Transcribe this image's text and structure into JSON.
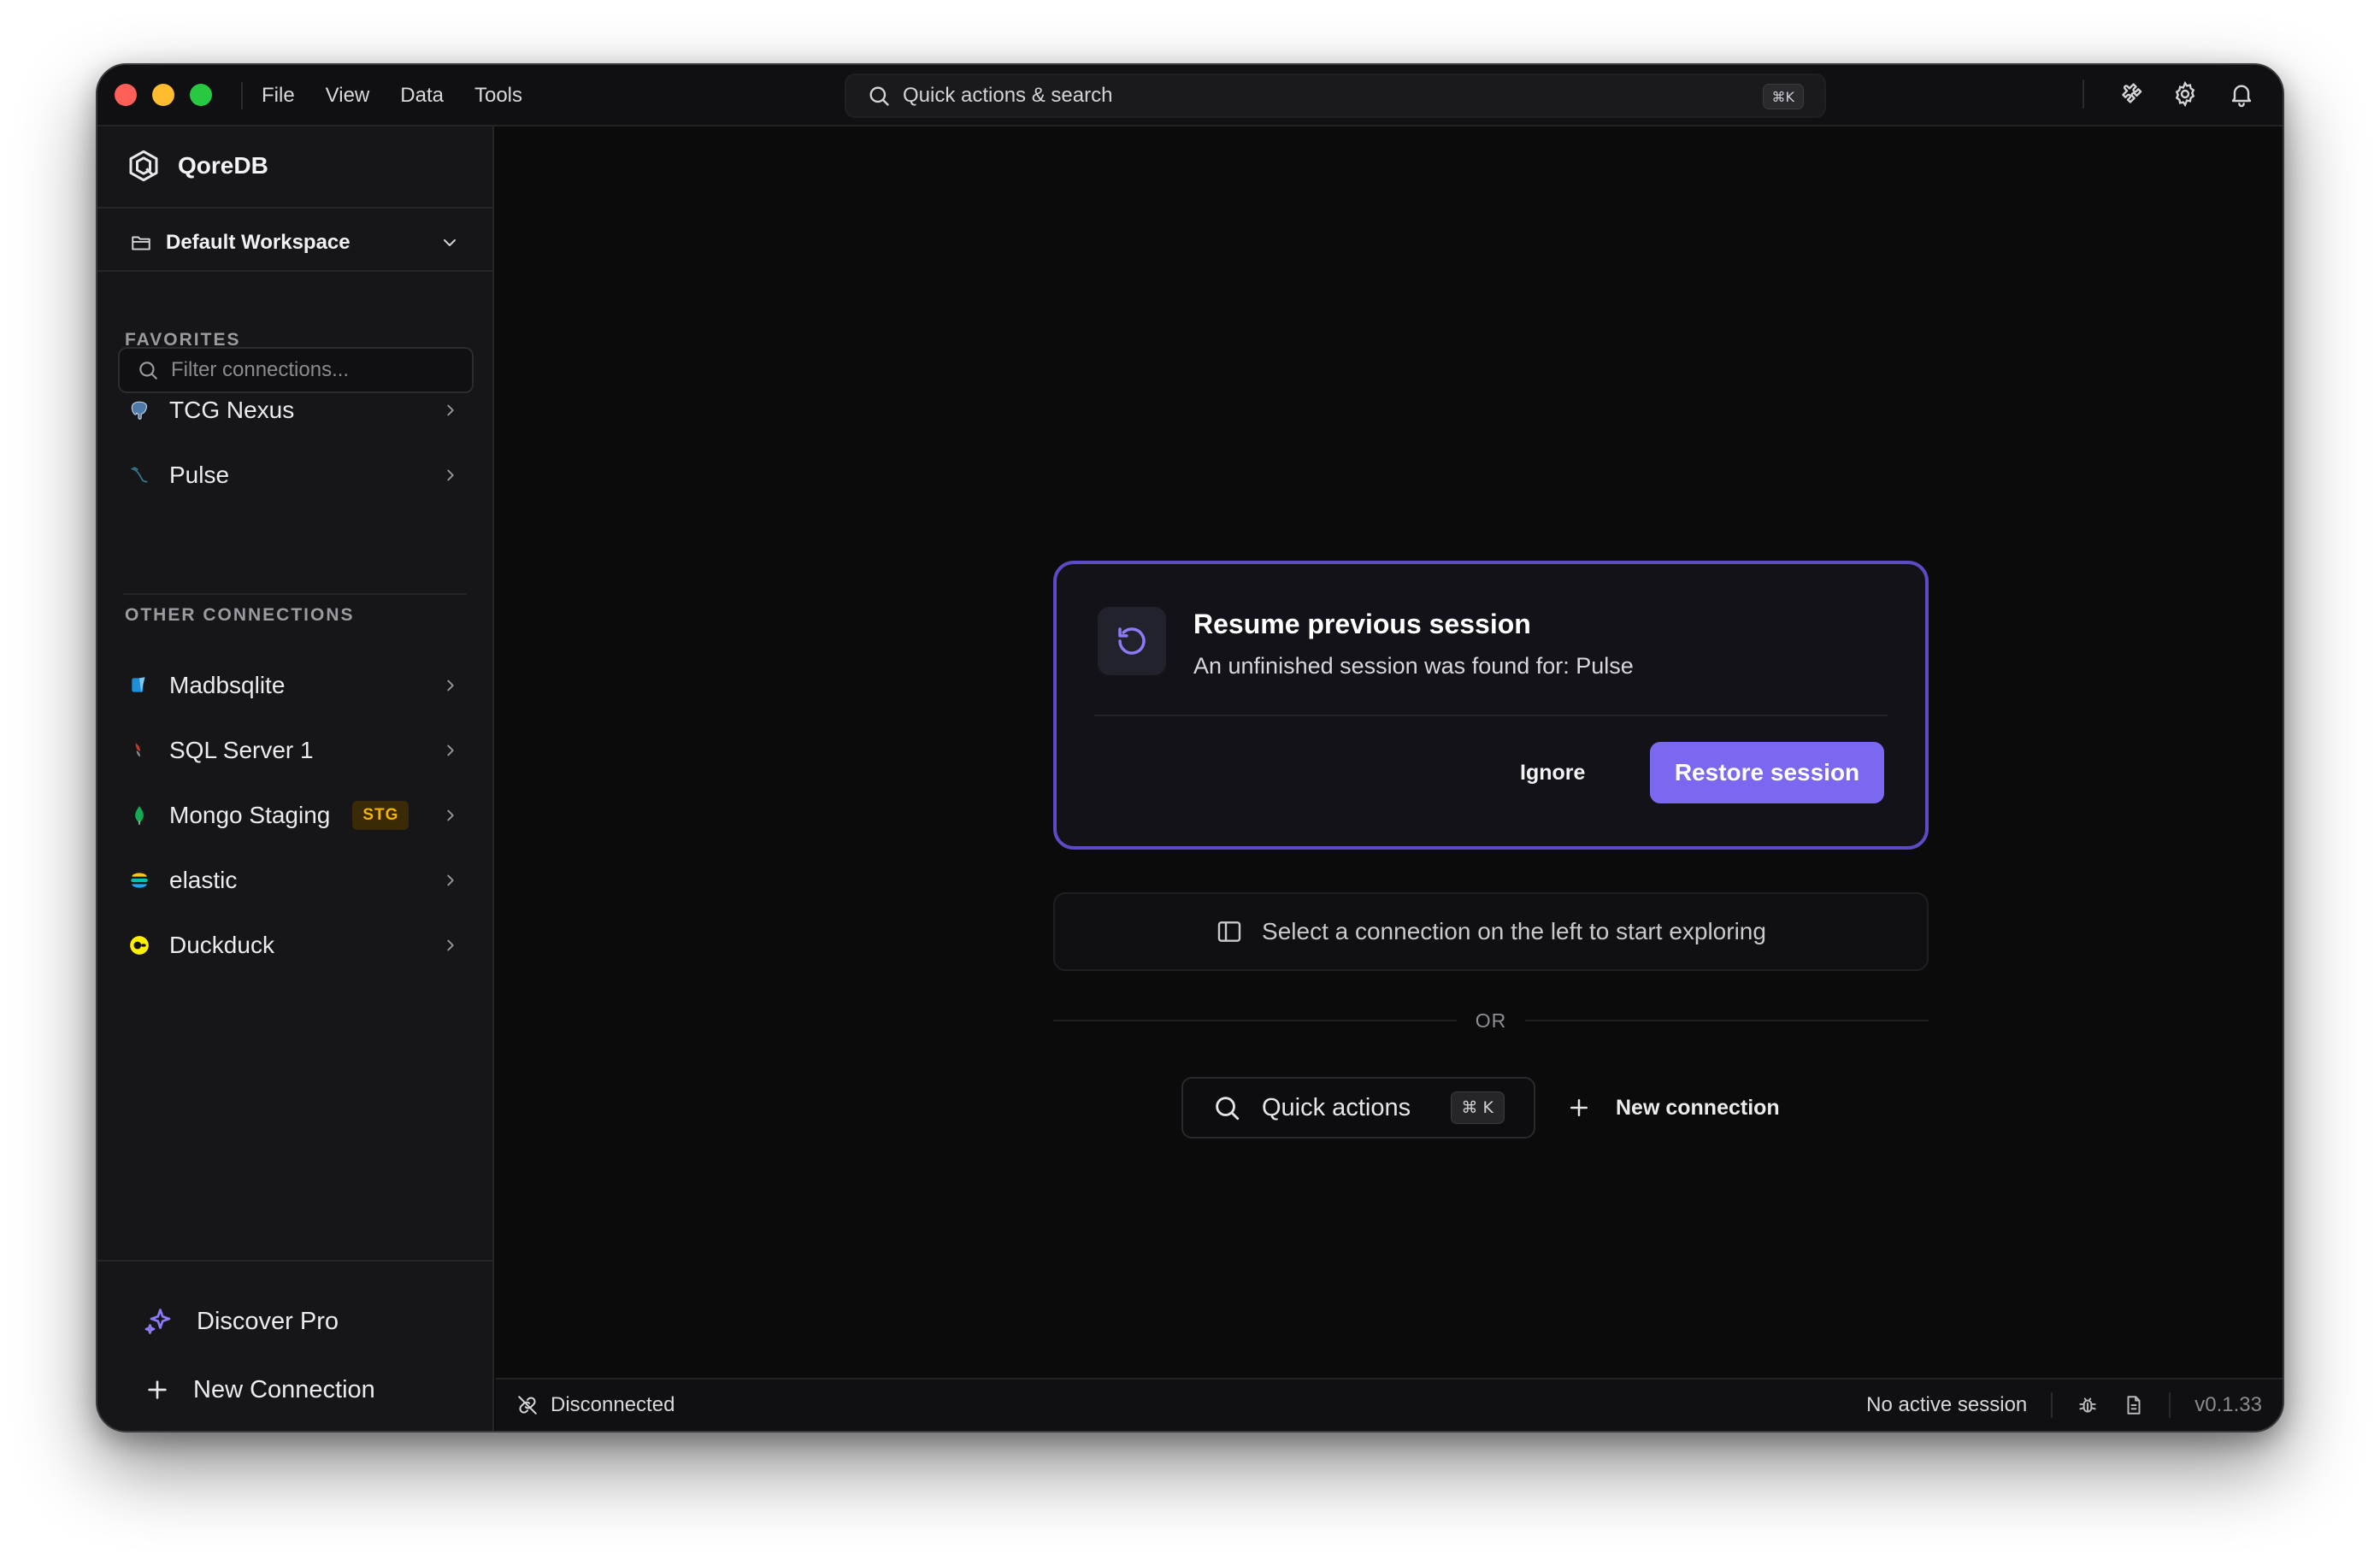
{
  "menu": {
    "items": [
      "File",
      "View",
      "Data",
      "Tools"
    ]
  },
  "search": {
    "placeholder": "Quick actions & search",
    "shortcut": "⌘K"
  },
  "app": {
    "name": "QoreDB"
  },
  "workspace": {
    "name": "Default Workspace"
  },
  "filter": {
    "placeholder": "Filter connections..."
  },
  "favorites": {
    "title": "FAVORITES",
    "items": [
      {
        "label": "TCG Nexus",
        "icon": "postgres-icon"
      },
      {
        "label": "Pulse",
        "icon": "mysql-icon"
      }
    ]
  },
  "other": {
    "title": "OTHER CONNECTIONS",
    "items": [
      {
        "label": "Madbsqlite",
        "icon": "sqlite-icon"
      },
      {
        "label": "SQL Server 1",
        "icon": "sqlserver-icon"
      },
      {
        "label": "Mongo Staging",
        "icon": "mongodb-icon",
        "badge": "STG"
      },
      {
        "label": "elastic",
        "icon": "elastic-icon"
      },
      {
        "label": "Duckduck",
        "icon": "duckdb-icon"
      }
    ]
  },
  "sidebar_bottom": {
    "discover": "Discover Pro",
    "new_connection": "New Connection"
  },
  "session_card": {
    "title": "Resume previous session",
    "subtitle": "An unfinished session was found for: Pulse",
    "ignore": "Ignore",
    "restore": "Restore session"
  },
  "hint": {
    "text": "Select a connection on the left to start exploring"
  },
  "or": "OR",
  "quick_actions": {
    "label": "Quick actions",
    "shortcut": "⌘ K"
  },
  "new_connection": {
    "label": "New connection"
  },
  "status": {
    "connection": "Disconnected",
    "session": "No active session",
    "version": "v0.1.33"
  },
  "colors": {
    "accent": "#7b68f0",
    "card_border": "#5b4bc4",
    "badge": "#f5b400",
    "background": "#0b0b0c",
    "sidebar": "#161618"
  }
}
